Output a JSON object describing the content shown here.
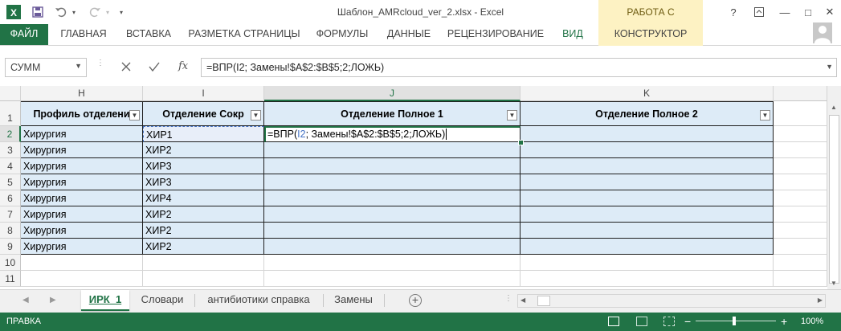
{
  "window": {
    "title": "Шаблон_AMRcloud_ver_2.xlsx - Excel",
    "context_header": "РАБОТА С ТАБЛИЦАМИ",
    "help": "?",
    "minimize": "—",
    "restore": "□",
    "close": "✕"
  },
  "ribbon": {
    "tabs": [
      "ФАЙЛ",
      "ГЛАВНАЯ",
      "ВСТАВКА",
      "РАЗМЕТКА СТРАНИЦЫ",
      "ФОРМУЛЫ",
      "ДАННЫЕ",
      "РЕЦЕНЗИРОВАНИЕ",
      "ВИД",
      "КОНСТРУКТОР"
    ]
  },
  "formula_bar": {
    "name_box": "СУММ",
    "fx": "fx",
    "formula": "=ВПР(I2; Замены!$A$2:$B$5;2;ЛОЖЬ)"
  },
  "grid": {
    "columns": [
      "H",
      "I",
      "J",
      "K"
    ],
    "headers": [
      "Профиль отделени",
      "Отделение Сокр",
      "Отделение Полное 1",
      "Отделение Полное 2"
    ],
    "row_numbers": [
      "1",
      "2",
      "3",
      "4",
      "5",
      "6",
      "7",
      "8",
      "9",
      "10",
      "11"
    ],
    "rows": [
      {
        "h": "Хирургия",
        "i": "ХИР1"
      },
      {
        "h": "Хирургия",
        "i": "ХИР2"
      },
      {
        "h": "Хирургия",
        "i": "ХИР3"
      },
      {
        "h": "Хирургия",
        "i": "ХИР3"
      },
      {
        "h": "Хирургия",
        "i": "ХИР4"
      },
      {
        "h": "Хирургия",
        "i": "ХИР2"
      },
      {
        "h": "Хирургия",
        "i": "ХИР2"
      },
      {
        "h": "Хирургия",
        "i": "ХИР2"
      }
    ],
    "edit_cell": {
      "prefix": "=ВПР(",
      "ref": "I2",
      "suffix": "; Замены!$A$2:$B$5;2;ЛОЖЬ)"
    }
  },
  "sheets": {
    "tabs": [
      "ИРК_1",
      "Словари",
      "антибиотики справка",
      "Замены"
    ],
    "active": "ИРК_1",
    "add": "+"
  },
  "status": {
    "mode": "ПРАВКА",
    "zoom": "100%",
    "zoom_minus": "−",
    "zoom_plus": "+"
  },
  "colors": {
    "excel_green": "#217346",
    "table_fill": "#ddebf7",
    "context_tab": "#fdf2c3",
    "ref_blue": "#4472c4"
  }
}
